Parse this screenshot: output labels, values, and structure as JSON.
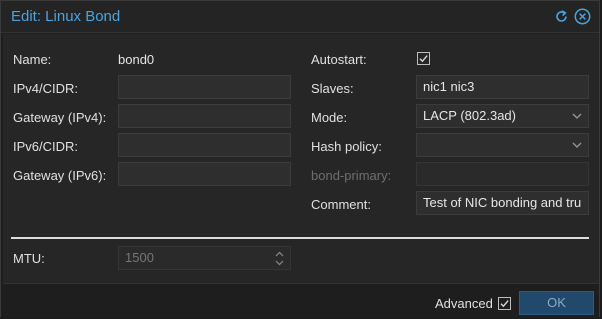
{
  "dialog": {
    "title": "Edit: Linux Bond",
    "icons": [
      "refresh-icon",
      "close-icon"
    ]
  },
  "left": {
    "name_label": "Name:",
    "name_value": "bond0",
    "ipv4_label": "IPv4/CIDR:",
    "ipv4_value": "",
    "gateway4_label": "Gateway (IPv4):",
    "gateway4_value": "",
    "ipv6_label": "IPv6/CIDR:",
    "ipv6_value": "",
    "gateway6_label": "Gateway (IPv6):",
    "gateway6_value": ""
  },
  "right": {
    "autostart_label": "Autostart:",
    "autostart_checked": true,
    "slaves_label": "Slaves:",
    "slaves_value": "nic1 nic3",
    "mode_label": "Mode:",
    "mode_value": "LACP (802.3ad)",
    "hash_label": "Hash policy:",
    "hash_value": "",
    "bond_primary_label": "bond-primary:",
    "bond_primary_value": "",
    "comment_label": "Comment:",
    "comment_value": "Test of NIC bonding and tru"
  },
  "mtu": {
    "label": "MTU:",
    "placeholder": "1500"
  },
  "footer": {
    "advanced_label": "Advanced",
    "advanced_checked": true,
    "ok_label": "OK"
  },
  "colors": {
    "accent": "#4aa3df",
    "ok_button": "#21496b"
  }
}
